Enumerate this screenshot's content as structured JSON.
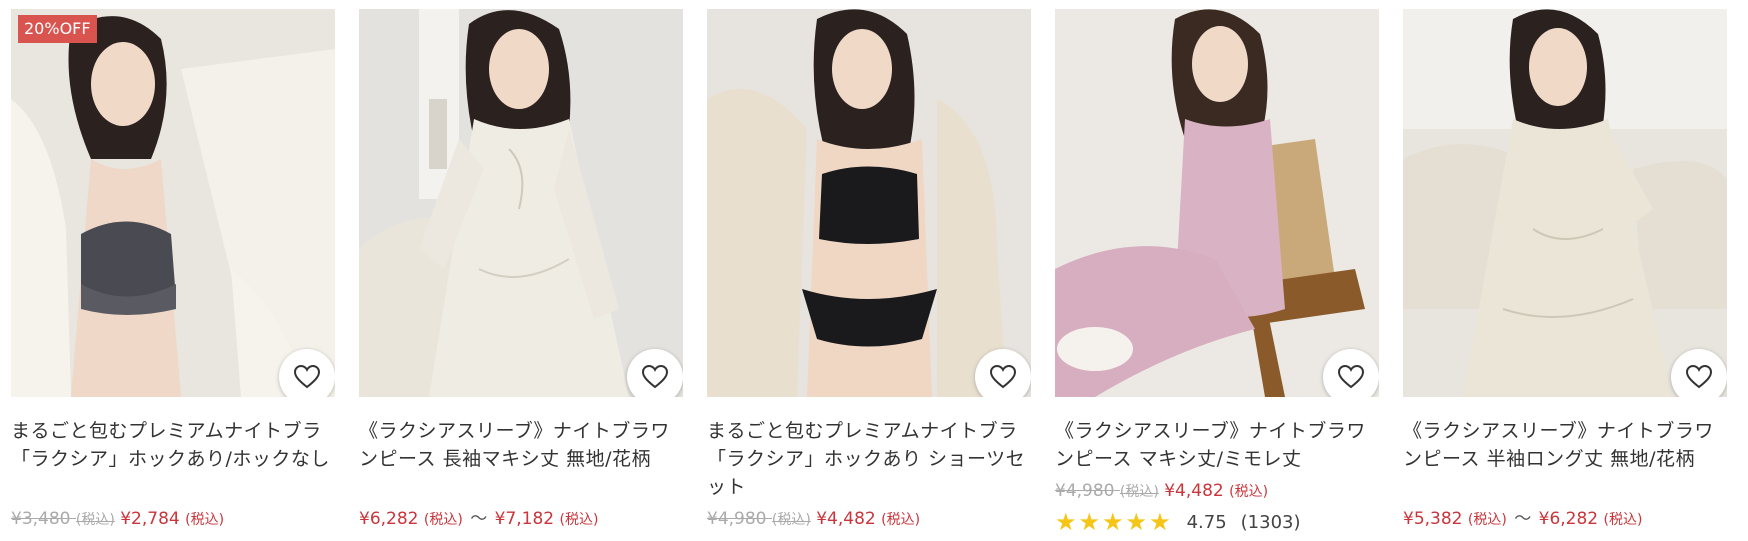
{
  "products": [
    {
      "badge": "20%OFF",
      "title": "まるごと包むプレミアムナイトブラ「ラクシア」ホックあり/ホックなし",
      "old_price": "¥3,480",
      "old_tax": "(税込)",
      "price": "¥2,784",
      "price_tax": "(税込)"
    },
    {
      "title": "《ラクシアスリーブ》ナイトブラワンピース 長袖マキシ丈 無地/花柄",
      "price_from": "¥6,282",
      "price_from_tax": "(税込)",
      "tilde": "〜",
      "price_to": "¥7,182",
      "price_to_tax": "(税込)"
    },
    {
      "title": "まるごと包むプレミアムナイトブラ「ラクシア」ホックあり ショーツセット",
      "old_price": "¥4,980",
      "old_tax": "(税込)",
      "price": "¥4,482",
      "price_tax": "(税込)"
    },
    {
      "title": "《ラクシアスリーブ》ナイトブラワンピース マキシ丈/ミモレ丈",
      "old_price": "¥4,980",
      "old_tax": "(税込)",
      "price": "¥4,482",
      "price_tax": "(税込)",
      "stars": "★★★★★",
      "rating": "4.75",
      "review_count": "(1303)"
    },
    {
      "title": "《ラクシアスリーブ》ナイトブラワンピース 半袖ロング丈 無地/花柄",
      "price_from": "¥5,382",
      "price_from_tax": "(税込)",
      "tilde": "〜",
      "price_to": "¥6,282",
      "price_to_tax": "(税込)"
    }
  ],
  "icons": {
    "favorite": "heart-outline-icon",
    "rating": "star-icon"
  },
  "colors": {
    "sale_red": "#c9353b",
    "badge_bg": "#d9534f",
    "star_yellow": "#f5c518",
    "old_price_gray": "#aaaaaa"
  }
}
